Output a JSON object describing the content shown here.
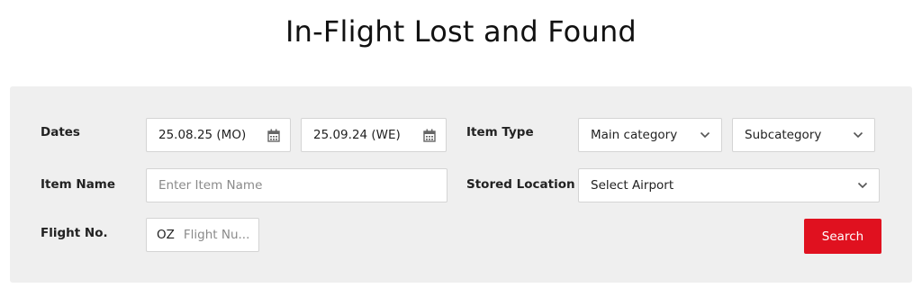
{
  "page": {
    "title": "In-Flight Lost and Found"
  },
  "form": {
    "dates": {
      "label": "Dates",
      "start": "25.08.25 (MO)",
      "end": "25.09.24 (WE)"
    },
    "item_type": {
      "label": "Item Type",
      "main_category": "Main category",
      "subcategory": "Subcategory"
    },
    "item_name": {
      "label": "Item Name",
      "placeholder": "Enter Item Name"
    },
    "stored_location": {
      "label": "Stored Location",
      "value": "Select Airport"
    },
    "flight_no": {
      "label": "Flight No.",
      "prefix": "OZ",
      "placeholder": "Flight Nu..."
    },
    "search_label": "Search"
  },
  "icons": {
    "calendar": "calendar-icon",
    "dropdown": "chevron-down-icon"
  },
  "colors": {
    "panel_bg": "#efefef",
    "search_button": "#e0111f"
  }
}
